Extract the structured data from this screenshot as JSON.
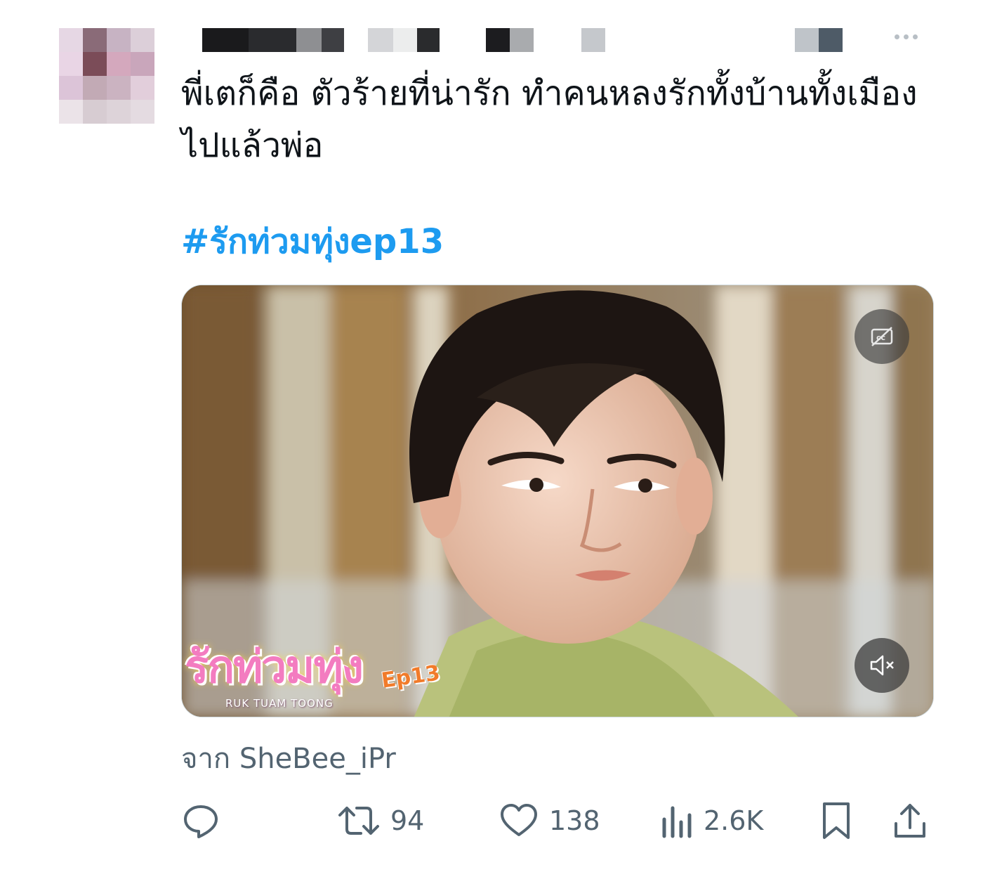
{
  "tweet": {
    "text": "พี่เตก็คือ ตัวร้ายที่น่ารัก ทำคนหลงรักทั้งบ้านทั้งเมืองไปแล้วพ่อ",
    "hashtag": "#รักท่วมทุ่งep13"
  },
  "media": {
    "logo_title": "รักท่วมทุ่ง",
    "logo_episode": "Ep13",
    "logo_subtitle": "RUK TUAM TOONG",
    "captions_icon": "captions-off-icon",
    "mute_icon": "volume-muted-icon"
  },
  "source": {
    "text": "จาก SheBee_iPr"
  },
  "actions": {
    "reply": {
      "icon": "reply-icon",
      "count": ""
    },
    "retweet": {
      "icon": "retweet-icon",
      "count": "94"
    },
    "like": {
      "icon": "heart-icon",
      "count": "138"
    },
    "views": {
      "icon": "views-bar-icon",
      "count": "2.6K"
    },
    "bookmark": {
      "icon": "bookmark-icon"
    },
    "share": {
      "icon": "share-icon"
    }
  },
  "colors": {
    "hashtag": "#1d9bf0",
    "secondary_text": "#536471",
    "text": "#0f1419"
  }
}
